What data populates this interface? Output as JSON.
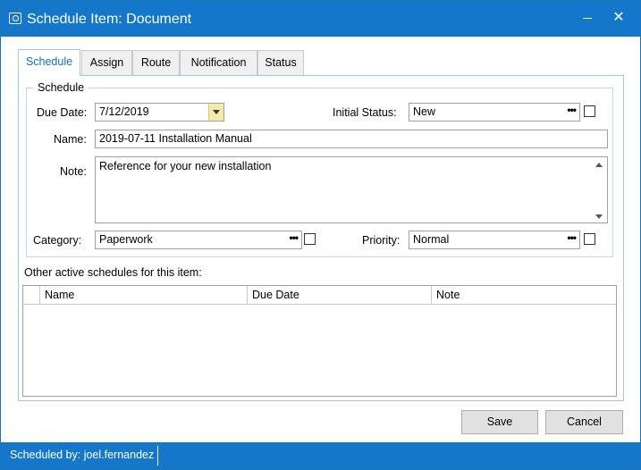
{
  "window": {
    "title": "Schedule Item: Document"
  },
  "tabs": [
    {
      "label": "Schedule",
      "active": true
    },
    {
      "label": "Assign"
    },
    {
      "label": "Route"
    },
    {
      "label": "Notification"
    },
    {
      "label": "Status"
    }
  ],
  "schedule": {
    "group_label": "Schedule",
    "due_date_label": "Due Date:",
    "due_date_value": "7/12/2019",
    "initial_status_label": "Initial Status:",
    "initial_status_value": "New",
    "name_label": "Name:",
    "name_value": "2019-07-11 Installation Manual",
    "note_label": "Note:",
    "note_value": "Reference for your new installation",
    "category_label": "Category:",
    "category_value": "Paperwork",
    "priority_label": "Priority:",
    "priority_value": "Normal"
  },
  "other_schedules": {
    "label": "Other active schedules for this item:",
    "columns": [
      "Name",
      "Due Date",
      "Note"
    ],
    "rows": []
  },
  "buttons": {
    "save": "Save",
    "cancel": "Cancel"
  },
  "status_bar": {
    "text": "Scheduled by: joel.fernandez"
  },
  "icons": {
    "app": "camera-icon",
    "minimize": "minimize-icon",
    "close": "close-icon",
    "ellipsis": "ellipsis-icon",
    "dropdown": "chevron-down-icon"
  },
  "colors": {
    "accent": "#1477c9",
    "date_button": "#f6eaa9"
  }
}
